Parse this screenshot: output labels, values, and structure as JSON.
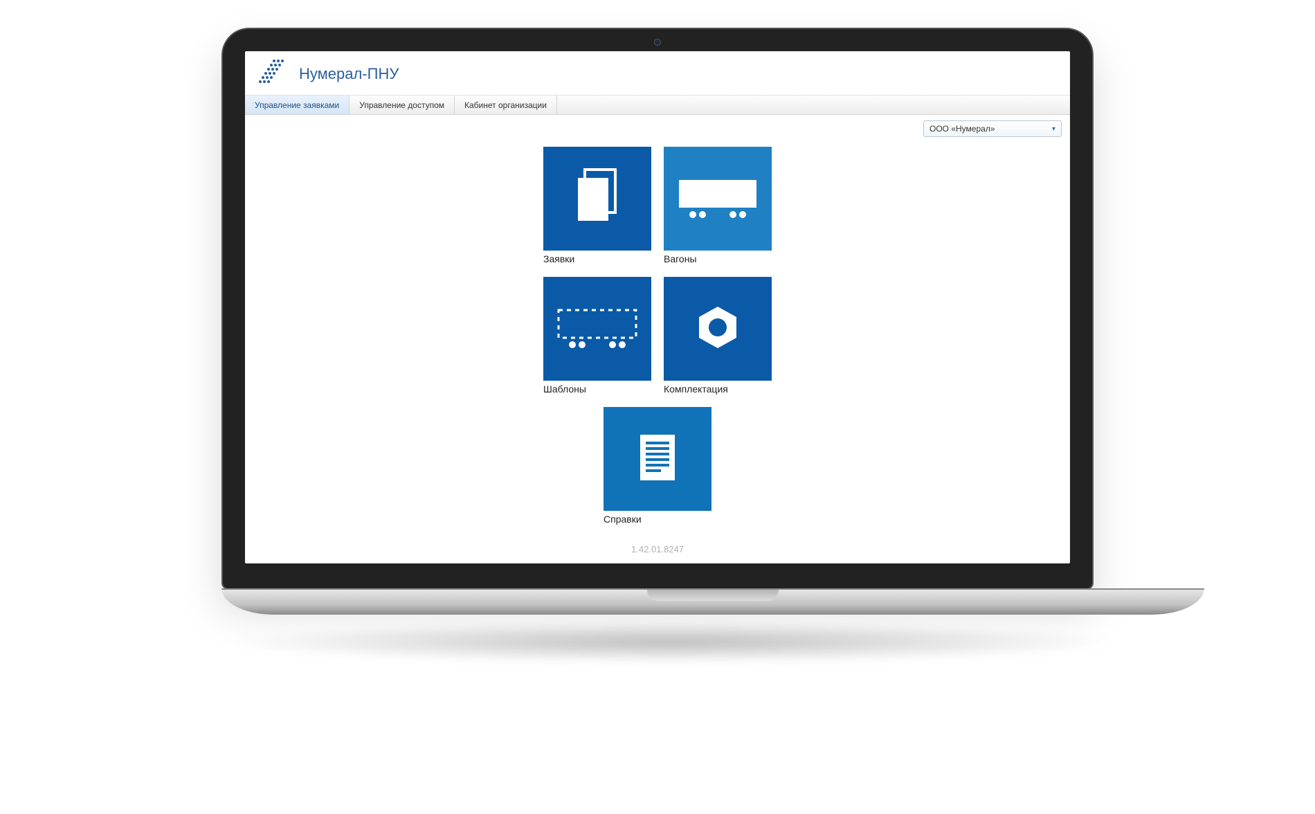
{
  "header": {
    "title": "Нумерал-ПНУ"
  },
  "tabs": [
    {
      "label": "Управление заявками",
      "active": true
    },
    {
      "label": "Управление доступом",
      "active": false
    },
    {
      "label": "Кабинет организации",
      "active": false
    }
  ],
  "org_select": {
    "selected": "ООО «Нумерал»"
  },
  "tiles": {
    "requests": {
      "label": "Заявки"
    },
    "wagons": {
      "label": "Вагоны"
    },
    "templates": {
      "label": "Шаблоны"
    },
    "equipment": {
      "label": "Комплектация"
    },
    "reports": {
      "label": "Справки"
    }
  },
  "footer": {
    "version": "1.42.01.8247"
  }
}
